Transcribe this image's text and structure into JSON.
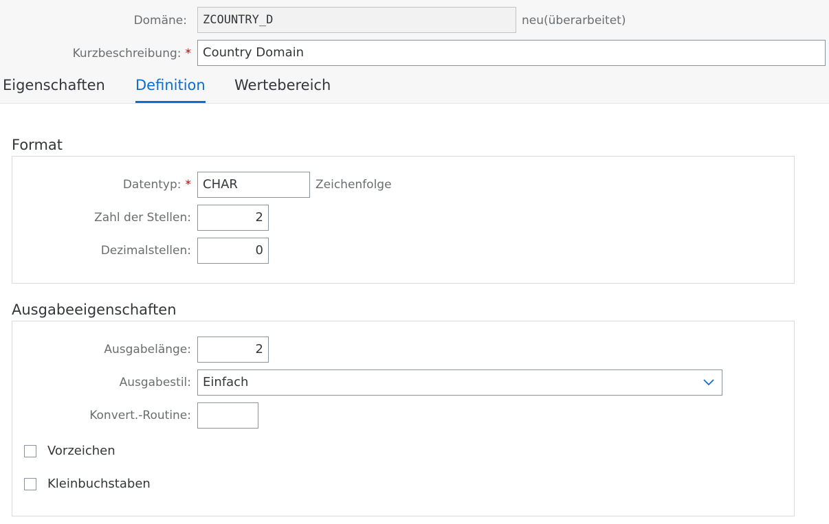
{
  "header": {
    "domain_label": "Domäne:",
    "domain_value": "ZCOUNTRY_D",
    "domain_status": "neu(überarbeitet)",
    "short_desc_label": "Kurzbeschreibung:",
    "short_desc_value": "Country Domain",
    "required_mark": "*"
  },
  "tabs": [
    {
      "label": "Eigenschaften",
      "active": false
    },
    {
      "label": "Definition",
      "active": true
    },
    {
      "label": "Wertebereich",
      "active": false
    }
  ],
  "format": {
    "title": "Format",
    "datatype_label": "Datentyp:",
    "datatype_value": "CHAR",
    "datatype_desc": "Zeichenfolge",
    "length_label": "Zahl der Stellen:",
    "length_value": "2",
    "decimals_label": "Dezimalstellen:",
    "decimals_value": "0"
  },
  "output": {
    "title": "Ausgabeeigenschaften",
    "output_length_label": "Ausgabelänge:",
    "output_length_value": "2",
    "output_style_label": "Ausgabestil:",
    "output_style_value": "Einfach",
    "conv_routine_label": "Konvert.-Routine:",
    "conv_routine_value": "",
    "sign_label": "Vorzeichen",
    "sign_checked": false,
    "lowercase_label": "Kleinbuchstaben",
    "lowercase_checked": false
  },
  "colors": {
    "accent": "#0a6ed1",
    "required": "#bb0000"
  },
  "icons": {
    "select": "chevron-down-icon"
  }
}
